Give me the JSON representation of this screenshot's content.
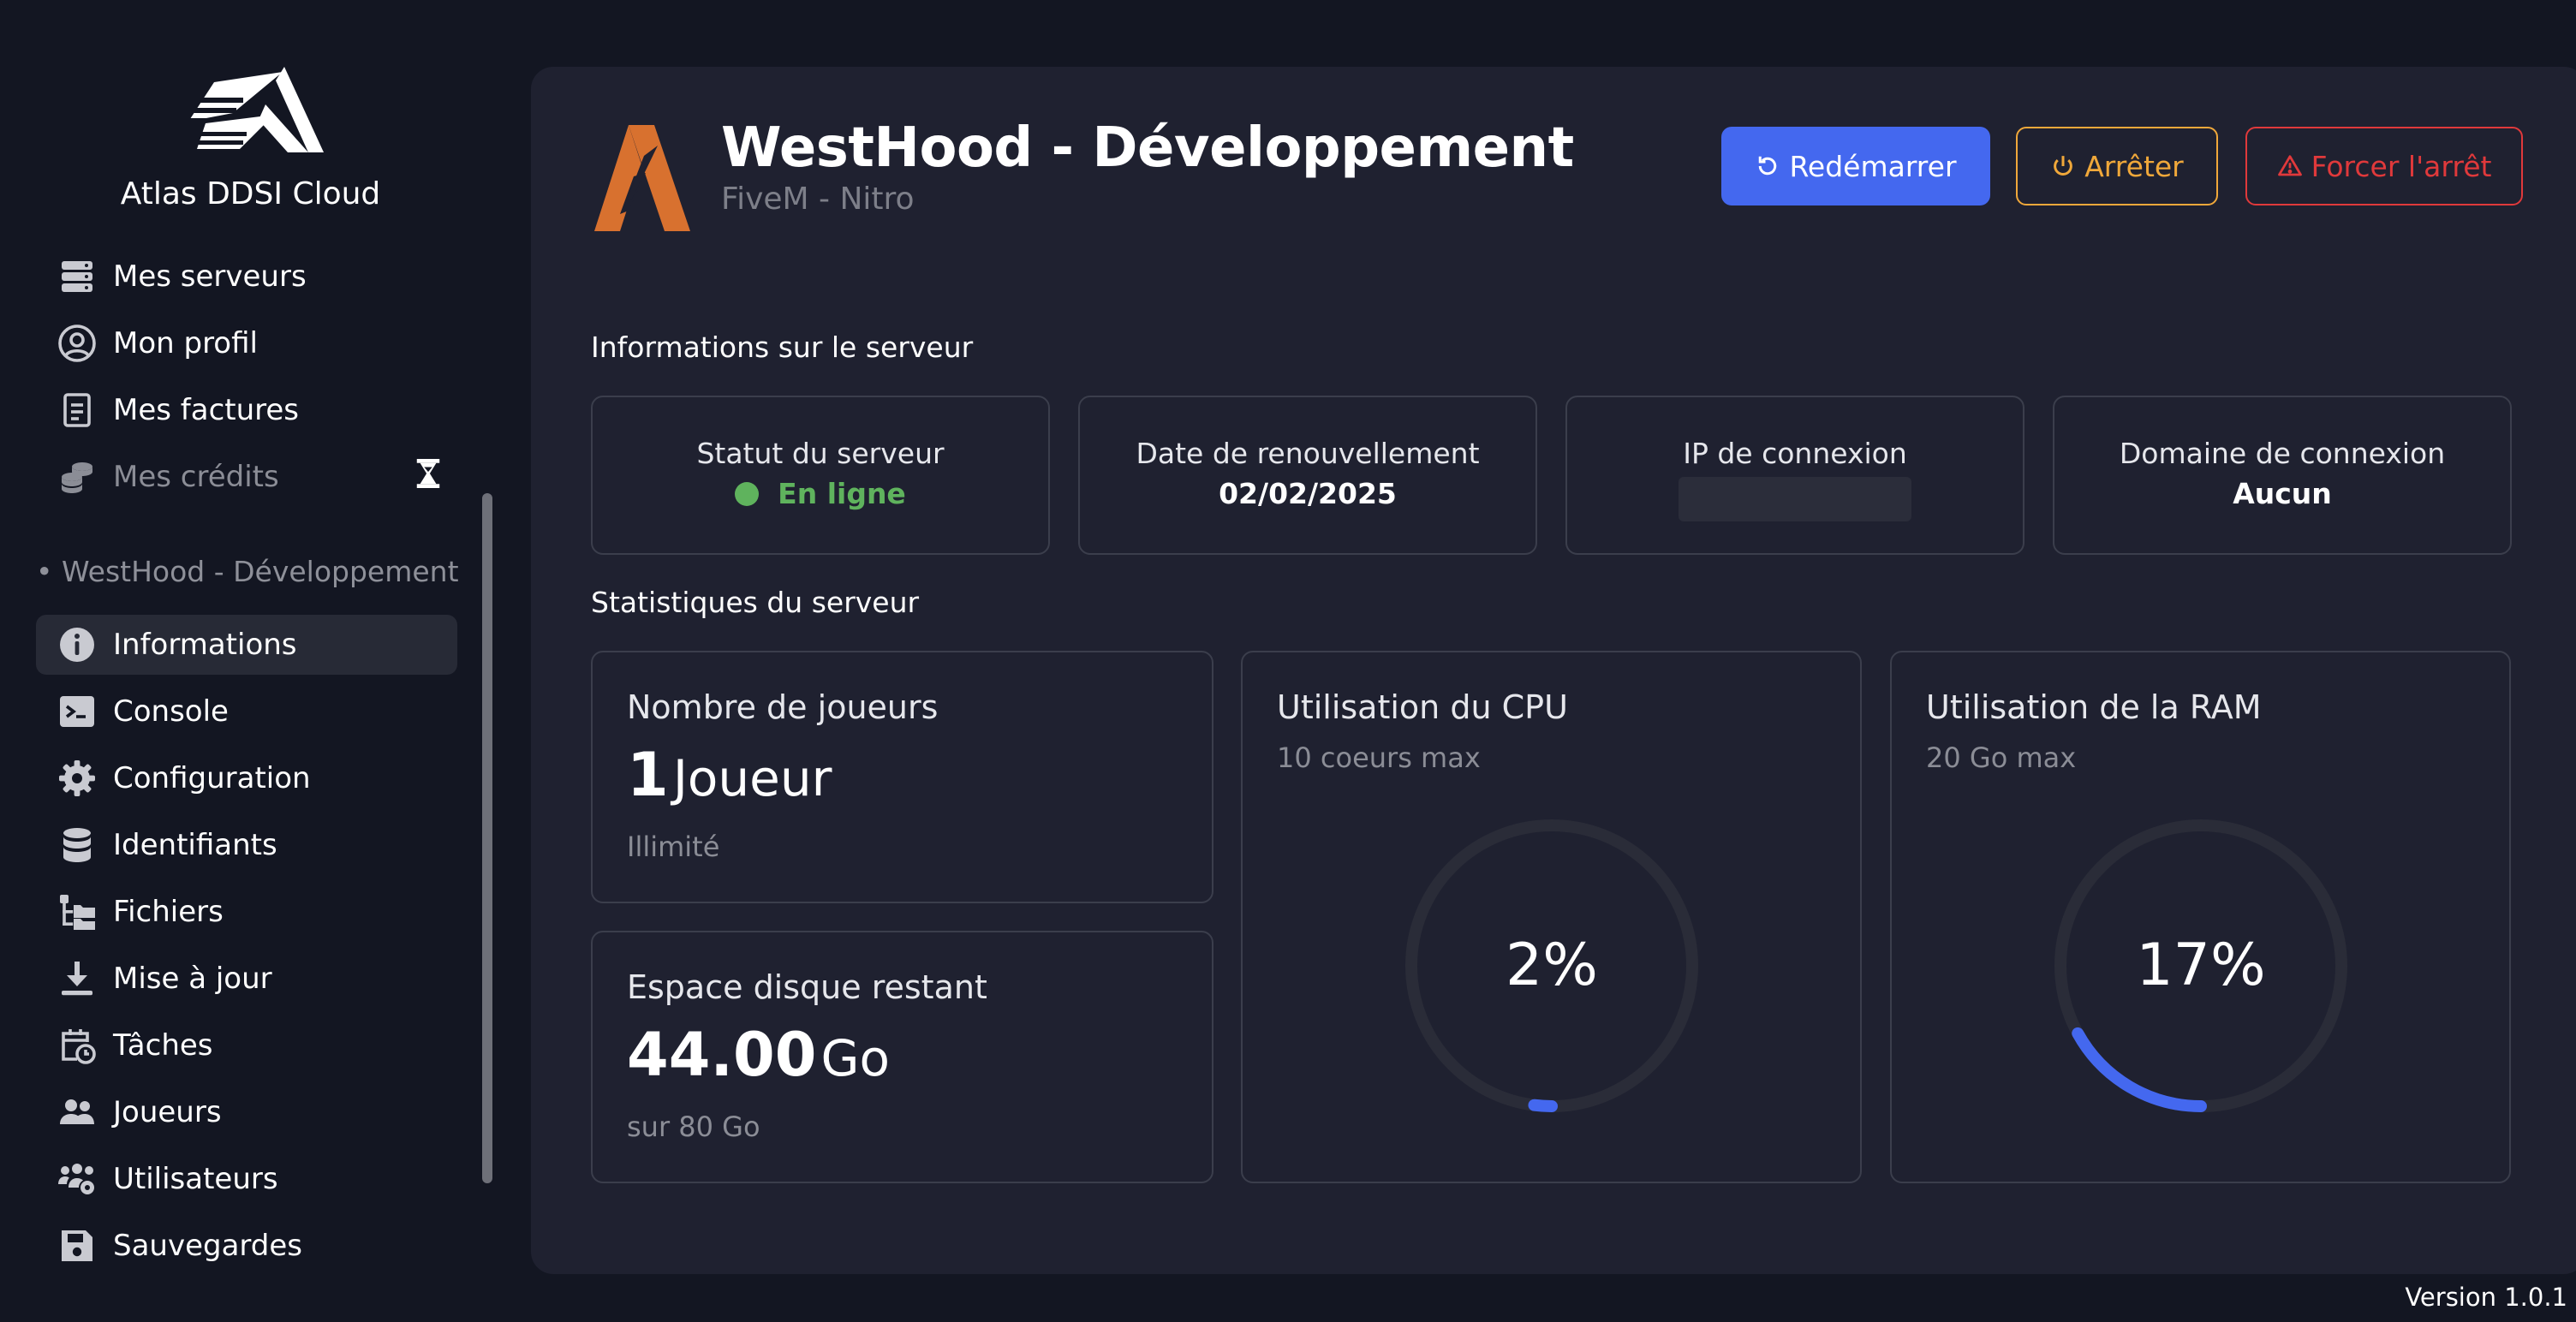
{
  "brand": {
    "name": "Atlas DDSI Cloud"
  },
  "sidebar": {
    "account_items": [
      {
        "label": "Mes serveurs",
        "icon": "server-stack-icon"
      },
      {
        "label": "Mon profil",
        "icon": "user-circle-icon"
      },
      {
        "label": "Mes factures",
        "icon": "invoice-icon"
      },
      {
        "label": "Mes crédits",
        "icon": "coins-icon",
        "disabled": true
      }
    ],
    "section_title": "• WestHood - Développement",
    "server_items": [
      {
        "label": "Informations",
        "icon": "info-icon",
        "active": true
      },
      {
        "label": "Console",
        "icon": "terminal-icon"
      },
      {
        "label": "Configuration",
        "icon": "gear-icon"
      },
      {
        "label": "Identifiants",
        "icon": "database-icon"
      },
      {
        "label": "Fichiers",
        "icon": "folder-tree-icon"
      },
      {
        "label": "Mise à jour",
        "icon": "download-icon"
      },
      {
        "label": "Tâches",
        "icon": "calendar-clock-icon"
      },
      {
        "label": "Joueurs",
        "icon": "users-icon"
      },
      {
        "label": "Utilisateurs",
        "icon": "users-gear-icon"
      },
      {
        "label": "Sauvegardes",
        "icon": "floppy-disk-icon"
      }
    ]
  },
  "header": {
    "title": "WestHood - Développement",
    "subtitle": "FiveM - Nitro",
    "buttons": {
      "restart": "Redémarrer",
      "stop": "Arrêter",
      "kill": "Forcer l'arrêt"
    }
  },
  "info": {
    "heading": "Informations sur le serveur",
    "status": {
      "label": "Statut du serveur",
      "value": "En ligne"
    },
    "renewal": {
      "label": "Date de renouvellement",
      "value": "02/02/2025"
    },
    "ip": {
      "label": "IP de connexion"
    },
    "domain": {
      "label": "Domaine de connexion",
      "value": "Aucun"
    }
  },
  "stats": {
    "heading": "Statistiques du serveur",
    "players": {
      "title": "Nombre de joueurs",
      "value": "1",
      "unit": "Joueur",
      "sub": "Illimité"
    },
    "disk": {
      "title": "Espace disque restant",
      "value": "44.00",
      "unit": "Go",
      "sub": "sur 80 Go"
    },
    "cpu": {
      "title": "Utilisation du CPU",
      "sub": "10 coeurs max",
      "percent": 2,
      "percent_label": "2%"
    },
    "ram": {
      "title": "Utilisation de la RAM",
      "sub": "20 Go max",
      "percent": 17,
      "percent_label": "17%"
    }
  },
  "colors": {
    "accent": "#4468ef",
    "online": "#5fb35d",
    "warning": "#f0a83a",
    "danger": "#e0393b",
    "gauge_track": "#2a2c38",
    "gauge_fill": "#4468ef",
    "logo_orange": "#d8712f"
  },
  "footer": {
    "version": "Version 1.0.1"
  }
}
